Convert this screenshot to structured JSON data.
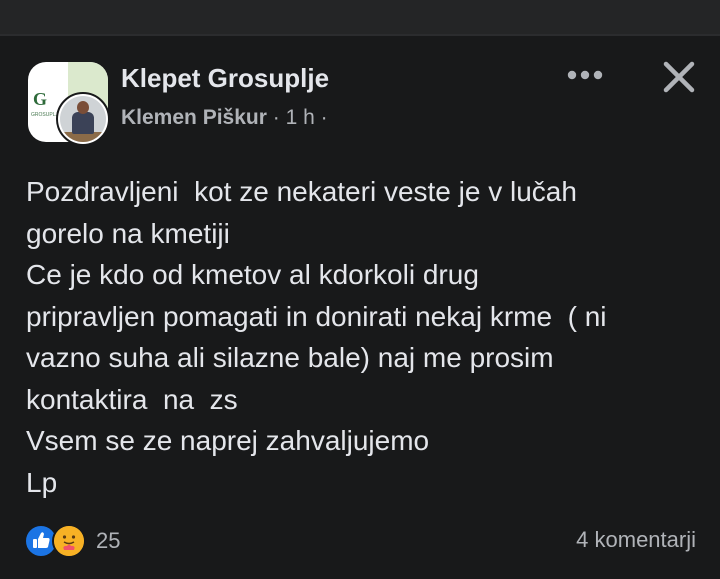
{
  "post": {
    "group_name": "Klepet Grosuplje",
    "author": "Klemen Piškur",
    "time": "1 h",
    "avatar_letter": "G",
    "avatar_caption": "GROSUPLJE",
    "body": "Pozdravljeni  kot ze nekateri veste je v lučah\ngorelo na kmetiji\nCe je kdo od kmetov al kdorkoli drug\npripravljen pomagati in donirati nekaj krme  ( ni\nvazno suha ali silazne bale) naj me prosim\nkontaktira  na  zs\nVsem se ze naprej zahvaljujemo\nLp",
    "reaction_count": "25",
    "comments_label": "4 komentarji"
  },
  "icons": {
    "more": "more-horizontal-icon",
    "close": "close-icon",
    "like": "like-reaction-icon",
    "care": "care-reaction-icon"
  },
  "colors": {
    "background": "#18191a",
    "primary_text": "#e4e6eb",
    "secondary_text": "#b0b3b8",
    "like_blue": "#1b74e4",
    "care_yellow": "#f7b125"
  }
}
